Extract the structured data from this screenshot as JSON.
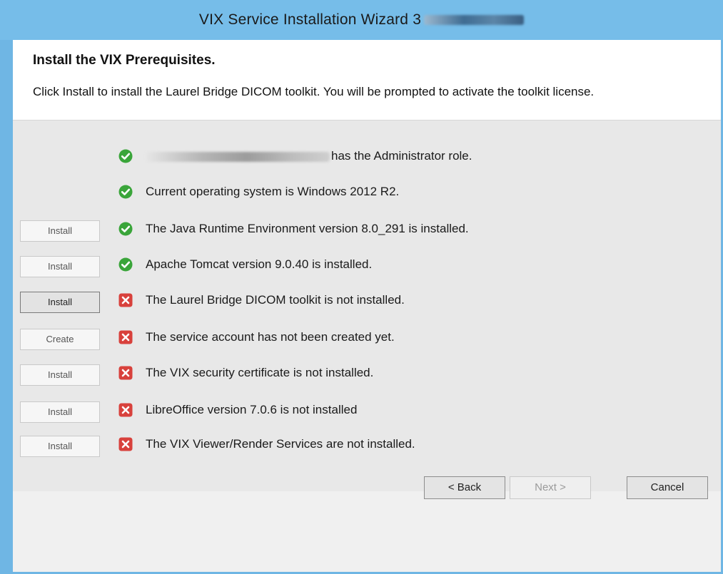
{
  "window": {
    "title": "VIX Service Installation Wizard 3"
  },
  "header": {
    "title": "Install the VIX Prerequisites.",
    "description": "Click Install to install the Laurel Bridge DICOM toolkit. You will be prompted to activate the toolkit license."
  },
  "prerequisites": [
    {
      "button": "",
      "status": "ok",
      "text": "has the Administrator role.",
      "redacted_prefix": true
    },
    {
      "button": "",
      "status": "ok",
      "text": "Current operating system is Windows 2012 R2."
    },
    {
      "button": "Install",
      "status": "ok",
      "text": "The Java Runtime Environment version 8.0_291 is installed."
    },
    {
      "button": "Install",
      "status": "ok",
      "text": "Apache Tomcat version 9.0.40 is installed."
    },
    {
      "button": "Install",
      "status": "error",
      "text": "The Laurel Bridge DICOM toolkit is not installed.",
      "button_active": true
    },
    {
      "button": "Create",
      "status": "error",
      "text": "The service account has not been created yet."
    },
    {
      "button": "Install",
      "status": "error",
      "text": "The VIX security certificate is not installed."
    },
    {
      "button": "Install",
      "status": "error",
      "text": "LibreOffice version 7.0.6 is not installed"
    },
    {
      "button": "Install",
      "status": "error",
      "text": "The VIX Viewer/Render Services are not installed."
    }
  ],
  "footer": {
    "back_label": "< Back",
    "next_label": "Next >",
    "cancel_label": "Cancel"
  },
  "colors": {
    "titlebar": "#76bde9",
    "ok_icon": "#3aa53a",
    "error_icon": "#d8413c"
  }
}
